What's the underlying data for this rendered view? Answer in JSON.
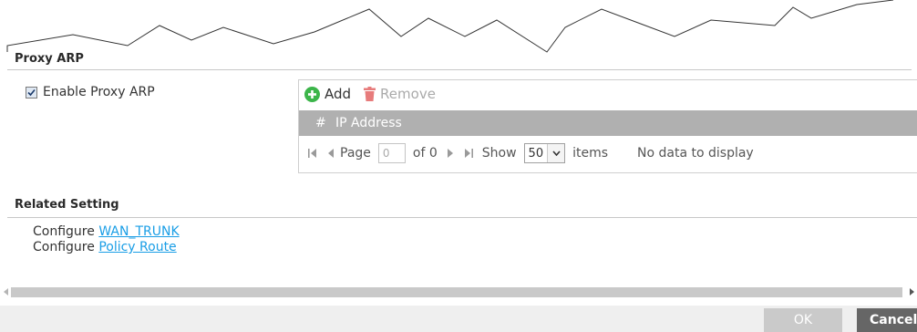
{
  "proxy_arp": {
    "section_title": "Proxy ARP",
    "enable_label": "Enable Proxy ARP",
    "enable_checked": true,
    "toolbar": {
      "add_label": "Add",
      "remove_label": "Remove"
    },
    "table": {
      "columns": [
        "#",
        "IP Address"
      ],
      "rows": []
    },
    "pager": {
      "page_label": "Page",
      "page_value": "0",
      "of_label": "of 0",
      "show_label": "Show",
      "show_value": "50",
      "items_label": "items",
      "status": "No data to display"
    }
  },
  "related": {
    "section_title": "Related Setting",
    "links": [
      {
        "prefix": "Configure",
        "link": "WAN_TRUNK"
      },
      {
        "prefix": "Configure",
        "link": "Policy Route"
      }
    ]
  },
  "footer": {
    "ok_label": "OK",
    "cancel_label": "Cancel"
  },
  "colors": {
    "accent_green": "#3cb54a",
    "remove_red": "#e77b7b",
    "link_blue": "#1a9ee6",
    "table_header": "#b0b0b0"
  }
}
